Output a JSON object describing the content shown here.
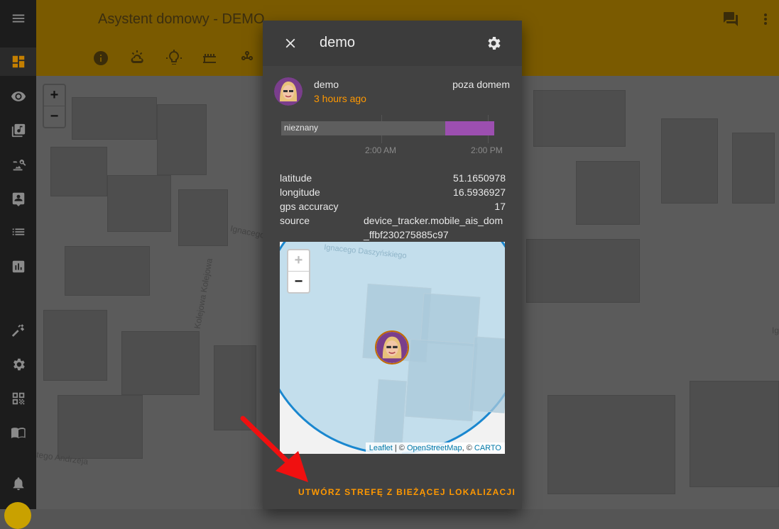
{
  "app": {
    "title": "Asystent domowy - DEMO"
  },
  "sidebar": {
    "items": [
      {
        "name": "menu-icon"
      },
      {
        "name": "dashboard-icon",
        "active": true
      },
      {
        "name": "eye-icon"
      },
      {
        "name": "music-library-icon"
      },
      {
        "name": "image-search-icon"
      },
      {
        "name": "account-box-icon"
      },
      {
        "name": "list-icon"
      },
      {
        "name": "chart-icon"
      },
      {
        "name": "hammer-icon"
      },
      {
        "name": "settings-icon"
      },
      {
        "name": "qr-code-icon"
      },
      {
        "name": "book-icon"
      },
      {
        "name": "bell-icon"
      }
    ]
  },
  "topbar": {
    "tabs": [
      "info-icon",
      "weather-icon",
      "lightbulb-icon",
      "radiator-icon",
      "nodes-icon"
    ],
    "actions": [
      "chat-icon",
      "more-vert-icon"
    ]
  },
  "background_map": {
    "streets": [
      "Ignacego",
      "Kolejowa Kolejowa",
      "tego Andrzeja",
      "Ig"
    ]
  },
  "dialog": {
    "title": "demo",
    "entity": {
      "name": "demo",
      "last_changed": "3 hours ago",
      "state": "poza domem"
    },
    "history": {
      "label": "nieznany",
      "ticks": [
        "2:00 AM",
        "2:00 PM"
      ],
      "unknown_color": "#5e5e5e",
      "away_color": "#9c4fb0"
    },
    "attributes": [
      {
        "key": "latitude",
        "value": "51.1650978"
      },
      {
        "key": "longitude",
        "value": "16.5936927"
      },
      {
        "key": "gps accuracy",
        "value": "17"
      },
      {
        "key": "source",
        "value": "device_tracker.mobile_ais_dom_ffbf230275885c97"
      }
    ],
    "map": {
      "street": "Ignacego Daszyńskiego",
      "zoom_in": "+",
      "zoom_out": "−",
      "attribution": {
        "leaflet": "Leaflet",
        "sep1": " | © ",
        "osm": "OpenStreetMap",
        "sep2": ", © ",
        "carto": "CARTO"
      },
      "accuracy_circle_color": "#1a87cf"
    },
    "create_zone_label": "UTWÓRZ STREFĘ Z BIEŻĄCEJ LOKALIZACJI"
  },
  "colors": {
    "accent": "#ff9800",
    "header_bg": "#7a5a00",
    "dialog_bg": "#424242"
  }
}
